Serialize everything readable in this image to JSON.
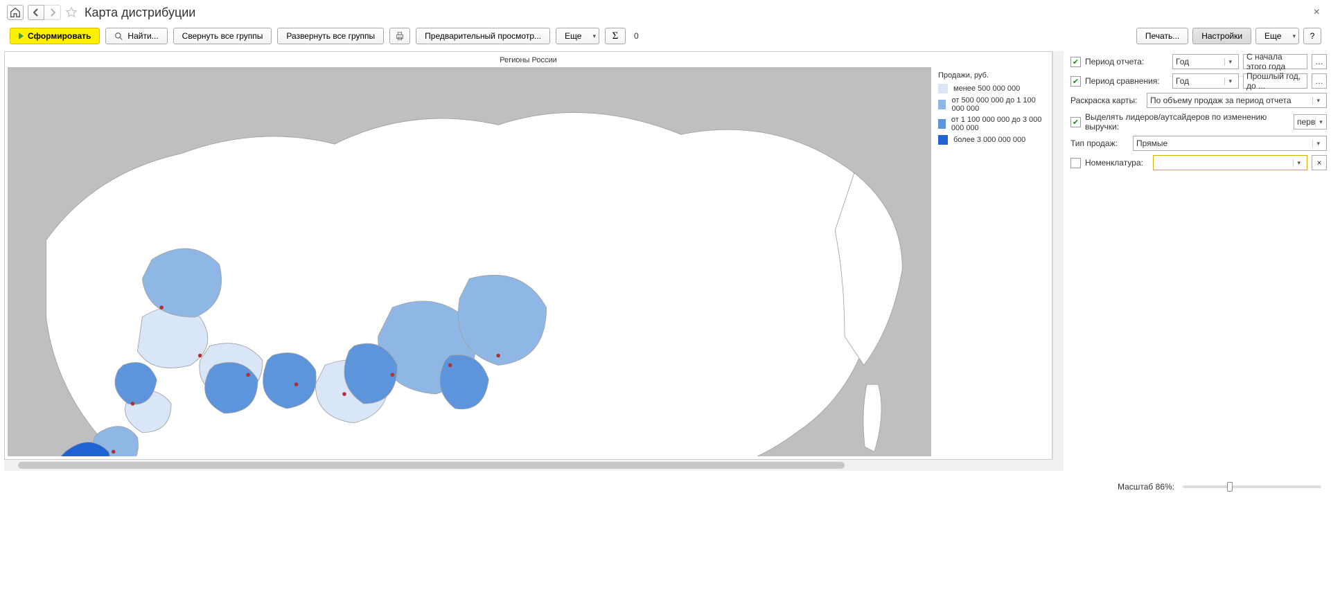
{
  "title": "Карта дистрибуции",
  "nav": {
    "home_icon": "home-icon",
    "back_icon": "arrow-left-icon",
    "forward_icon": "arrow-right-icon"
  },
  "toolbar": {
    "generate": "Сформировать",
    "find": "Найти...",
    "collapse_all": "Свернуть все группы",
    "expand_all": "Развернуть все группы",
    "preview": "Предварительный просмотр...",
    "more": "Еще",
    "sigma": "Σ",
    "count": "0",
    "print": "Печать...",
    "settings": "Настройки",
    "more2": "Еще",
    "help": "?"
  },
  "map": {
    "title": "Регионы России",
    "legend_title": "Продажи, руб.",
    "legend": [
      {
        "label": "менее 500 000 000",
        "color": "#d9e6f7"
      },
      {
        "label": "от 500 000 000 до 1 100 000 000",
        "color": "#8fb7e6"
      },
      {
        "label": "от 1 100 000 000 до 3 000 000 000",
        "color": "#5d95dd"
      },
      {
        "label": "более 3 000 000 000",
        "color": "#2062d4"
      }
    ]
  },
  "panel": {
    "period_report": {
      "checked": true,
      "label": "Период отчета:",
      "value": "Год",
      "range": "С начала этого года"
    },
    "period_compare": {
      "checked": true,
      "label": "Период сравнения:",
      "value": "Год",
      "range": "Прошлый год, до ..."
    },
    "coloring": {
      "label": "Раскраска карты:",
      "value": "По объему продаж за период отчета"
    },
    "highlight": {
      "checked": true,
      "label": "Выделять лидеров/аутсайдеров по изменению выручки:",
      "value": "перв"
    },
    "sale_type": {
      "label": "Тип продаж:",
      "value": "Прямые"
    },
    "nomenclature": {
      "checked": false,
      "label": "Номенклатура:",
      "value": ""
    }
  },
  "footer": {
    "scale_label": "Масштаб 86%:"
  }
}
